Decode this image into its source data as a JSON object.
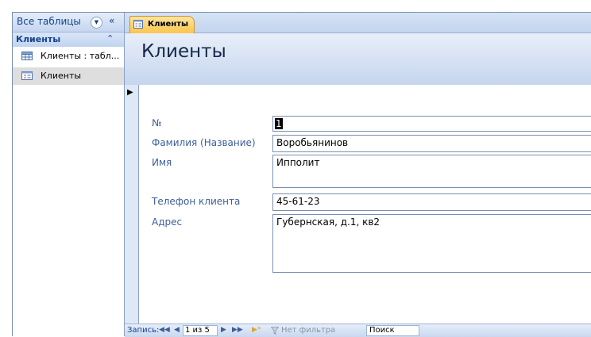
{
  "nav_pane": {
    "title": "Все таблицы",
    "collapse_symbol": "«",
    "dropdown_symbol": "▼",
    "group": {
      "title": "Клиенты",
      "chevron": "⌃"
    },
    "items": [
      {
        "label": "Клиенты : табл...",
        "icon": "table-icon"
      },
      {
        "label": "Клиенты",
        "icon": "form-icon",
        "selected": true
      }
    ]
  },
  "document_tab": {
    "label": "Клиенты",
    "icon": "form-icon"
  },
  "form": {
    "title": "Клиенты",
    "record_selector_symbol": "▶",
    "fields": [
      {
        "label": "№",
        "value": "1"
      },
      {
        "label": "Фамилия (Название)",
        "value": "Воробьянинов"
      },
      {
        "label": "Имя",
        "value": "Ипполит"
      },
      {
        "label": "Телефон клиента",
        "value": "45-61-23"
      },
      {
        "label": "Адрес",
        "value": "Губернская, д.1, кв2"
      }
    ]
  },
  "record_nav": {
    "label": "Запись:",
    "first": "◀◀",
    "prev": "◀",
    "position": "1 из 5",
    "next": "▶",
    "last": "▶▶",
    "new": "▶*",
    "filter_label": "Нет фильтра",
    "search_label": "Поиск"
  },
  "colors": {
    "accent": "#15428b",
    "label_blue": "#3c5f98",
    "tab_gold": "#f9c54d",
    "frame_blue": "#cfdcef"
  }
}
